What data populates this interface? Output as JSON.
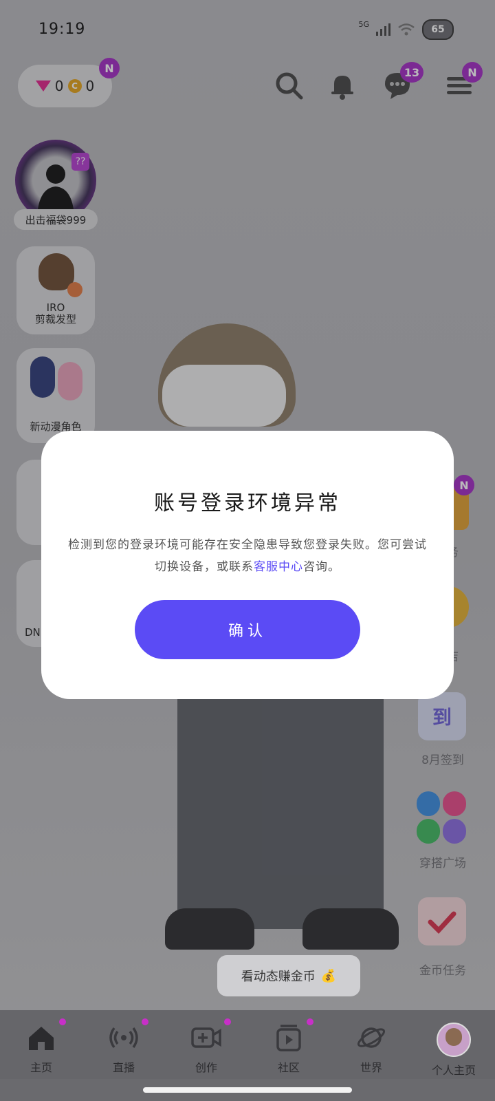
{
  "status": {
    "time": "19:19",
    "network": "5G",
    "battery": "65"
  },
  "header": {
    "gems": "0",
    "coins": "0",
    "wallet_badge": "N",
    "chat_badge": "13",
    "menu_badge": "N",
    "coin_symbol": "C"
  },
  "left": {
    "grab_bag_label": "出击福袋999",
    "card1_title": "IRO",
    "card1_label": "剪裁发型",
    "card2_label": "新动漫角色",
    "card4_label": "DN"
  },
  "right": {
    "badge": "N",
    "item1_label": "任务",
    "item2_label": "商店",
    "item3_icon_text": "到",
    "item3_label": "8月签到",
    "item4_label": "穿搭广场",
    "item5_label": "金币任务"
  },
  "modal": {
    "title": "账号登录环境异常",
    "message_prefix": "检测到您的登录环境可能存在安全隐患导致您登录失败。您可尝试切换设备，或联系",
    "message_link": "客服中心",
    "message_suffix": "咨询。",
    "confirm_label": "确认"
  },
  "promo": {
    "label": "看动态赚金币",
    "icon": "💰"
  },
  "nav": {
    "items": [
      {
        "label": "主页"
      },
      {
        "label": "直播"
      },
      {
        "label": "创作"
      },
      {
        "label": "社区"
      },
      {
        "label": "世界"
      },
      {
        "label": "个人主页"
      }
    ]
  },
  "colors": {
    "accent": "#5b4bf5",
    "badge": "#a22bc4",
    "modal_bg": "#ffffff"
  }
}
